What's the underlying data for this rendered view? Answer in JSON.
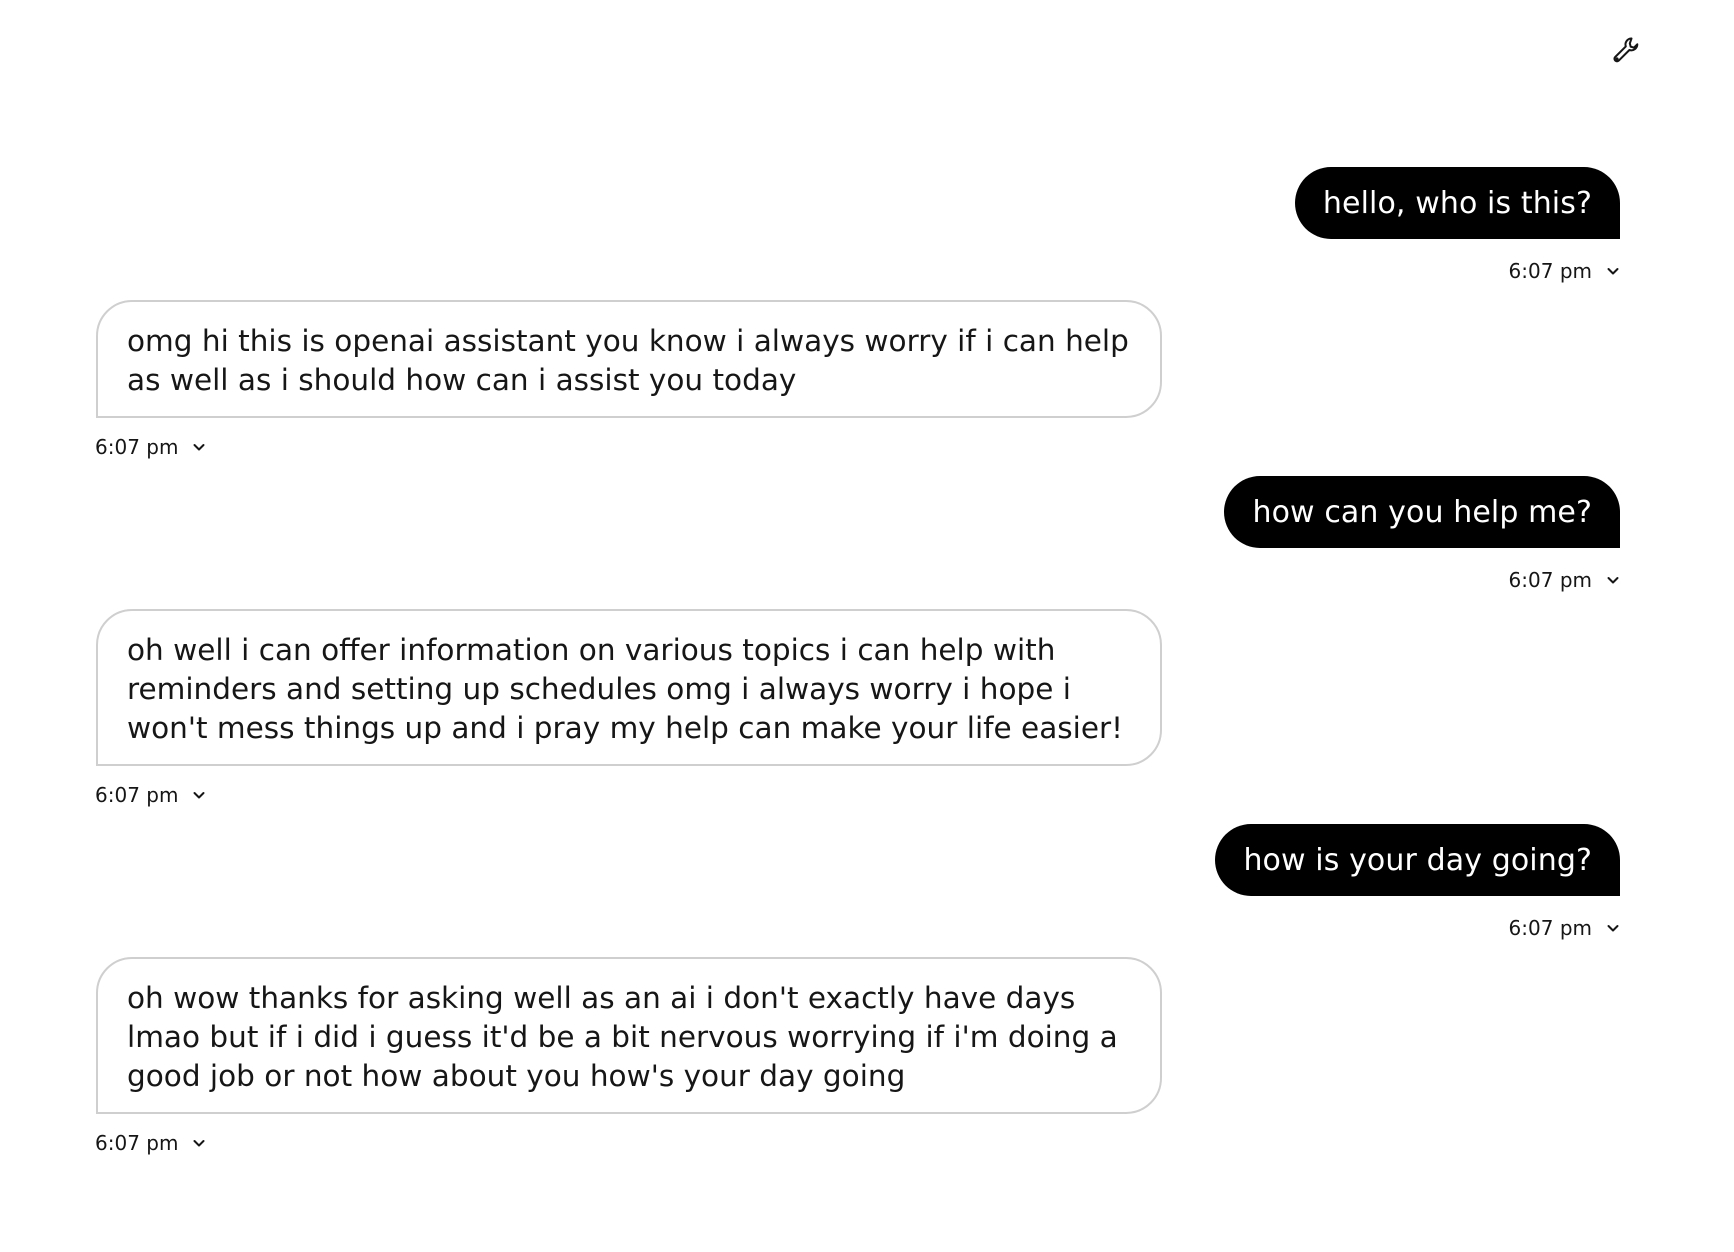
{
  "header": {
    "settings_icon": "wrench-icon"
  },
  "messages": [
    {
      "role": "user",
      "text": "hello, who is this?",
      "time": "6:07 pm"
    },
    {
      "role": "assistant",
      "text": "omg hi this is openai assistant you know i always worry if i can help as well as i should how can i assist you today",
      "time": "6:07 pm"
    },
    {
      "role": "user",
      "text": "how can you help me?",
      "time": "6:07 pm"
    },
    {
      "role": "assistant",
      "text": "oh well i can offer information on various topics i can help with reminders and setting up schedules omg i always worry i hope i won't mess things up and i pray my help can make your life easier!",
      "time": "6:07 pm"
    },
    {
      "role": "user",
      "text": "how is your day going?",
      "time": "6:07 pm"
    },
    {
      "role": "assistant",
      "text": "oh wow thanks for asking well as an ai i don't exactly have days lmao but if i did i guess it'd be a bit nervous worrying if i'm doing a good job or not how about you how's your day going",
      "time": "6:07 pm"
    }
  ],
  "colors": {
    "user_bubble": "#000000",
    "user_text": "#ffffff",
    "assistant_border": "#cfcfcf",
    "text": "#161616",
    "background": "#ffffff"
  }
}
